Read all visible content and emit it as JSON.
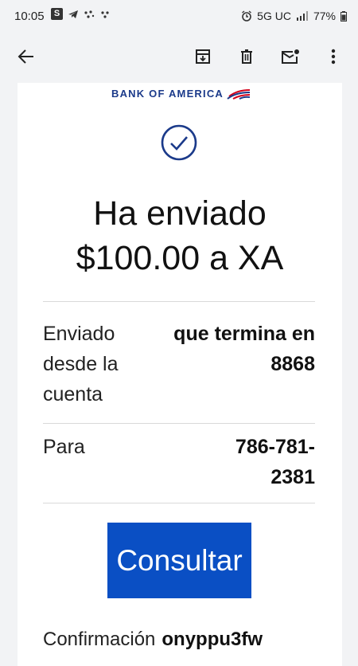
{
  "status_bar": {
    "time": "10:05",
    "s_badge": "S",
    "network": "5G UC",
    "battery": "77%"
  },
  "toolbar": {
    "icons": [
      "back-arrow-icon",
      "archive-icon",
      "delete-icon",
      "mark-unread-icon",
      "more-vert-icon"
    ]
  },
  "email": {
    "brand": "BANK OF AMERICA",
    "headline_line1": "Ha enviado",
    "headline_line2": "$100.00 a XA",
    "rows": [
      {
        "label": "Enviado desde la cuenta",
        "value": "que termina en 8868"
      },
      {
        "label": "Para",
        "value": "786-781-2381"
      }
    ],
    "cta_label": "Consultar",
    "confirmation_label": "Confirmación",
    "confirmation_value": "onyppu3fw"
  },
  "colors": {
    "brand_blue": "#1b3a8a",
    "brand_red": "#d4001a",
    "cta_blue": "#0a4fc4"
  }
}
